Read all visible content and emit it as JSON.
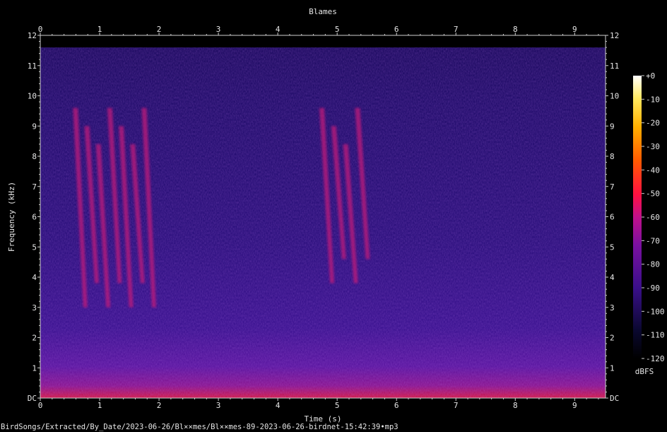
{
  "chart_data": {
    "type": "heatmap",
    "title": "Blames",
    "xlabel": "Time (s)",
    "ylabel": "Frequency (kHz)",
    "xlim": [
      0,
      9.52
    ],
    "ylim": [
      0,
      12
    ],
    "x_ticks": [
      "0",
      "1",
      "2",
      "3",
      "4",
      "5",
      "6",
      "7",
      "8",
      "9"
    ],
    "y_ticks": [
      "DC",
      "1",
      "2",
      "3",
      "4",
      "5",
      "6",
      "7",
      "8",
      "9",
      "10",
      "11",
      "12"
    ],
    "colorbar": {
      "unit": "dBFS",
      "range": [
        -120,
        0
      ],
      "ticks": [
        "+0",
        "-10",
        "-20",
        "-30",
        "-40",
        "-50",
        "-60",
        "-70",
        "-80",
        "-90",
        "-100",
        "-110",
        "-120"
      ]
    },
    "content_cutoff_khz": 11.6,
    "calls": [
      {
        "start_s": 0.55,
        "end_s": 1.9,
        "low_khz": 3.0,
        "high_khz": 9.6
      },
      {
        "start_s": 4.7,
        "end_s": 5.5,
        "low_khz": 3.8,
        "high_khz": 9.6
      }
    ],
    "footer": "BirdSongs/Extracted/By_Date/2023-06-26/Bl××mes/Bl××mes-89-2023-06-26-birdnet-15:42:39•mp3"
  }
}
